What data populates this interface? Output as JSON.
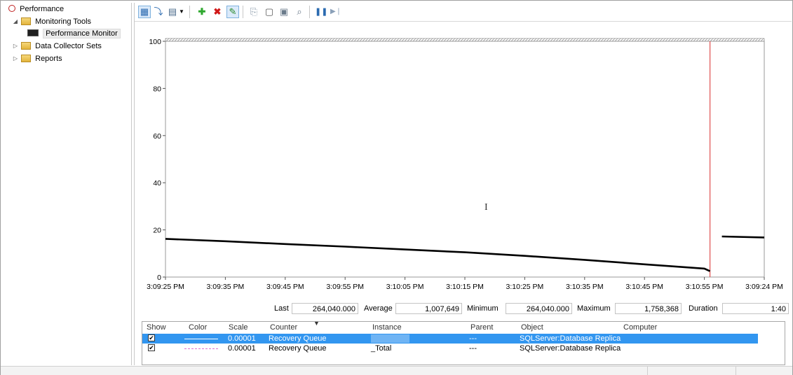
{
  "tree": {
    "items": [
      {
        "label": "Performance",
        "icon": "performance-icon",
        "twisty": ""
      },
      {
        "label": "Monitoring Tools",
        "icon": "folder-icon",
        "twisty": "◢"
      },
      {
        "label": "Performance Monitor",
        "icon": "monitor-icon",
        "twisty": ""
      },
      {
        "label": "Data Collector Sets",
        "icon": "folder-icon",
        "twisty": "▷"
      },
      {
        "label": "Reports",
        "icon": "folder-icon",
        "twisty": "▷"
      }
    ]
  },
  "toolbar": {
    "buttons": [
      {
        "name": "change-graph-type-button",
        "glyph": "▦"
      },
      {
        "name": "view-current-activity-button",
        "glyph": "⤵"
      },
      {
        "name": "change-graph-view-button",
        "glyph": "▤"
      },
      {
        "name": "add-counter-button",
        "glyph": "✚"
      },
      {
        "name": "delete-counter-button",
        "glyph": "✖"
      },
      {
        "name": "highlight-button",
        "glyph": "✎"
      },
      {
        "name": "copy-properties-button",
        "glyph": "⎘"
      },
      {
        "name": "paste-counter-list-button",
        "glyph": "▢"
      },
      {
        "name": "properties-button",
        "glyph": "▣"
      },
      {
        "name": "zoom-button",
        "glyph": "⌕"
      },
      {
        "name": "freeze-display-button",
        "glyph": "❚❚"
      },
      {
        "name": "update-data-button",
        "glyph": "▶❘"
      }
    ]
  },
  "chart_data": {
    "type": "line",
    "ylim": [
      0,
      100
    ],
    "yticks": [
      "0",
      "20",
      "40",
      "60",
      "80",
      "100"
    ],
    "xticks": [
      "3:09:25 PM",
      "3:09:35 PM",
      "3:09:45 PM",
      "3:09:55 PM",
      "3:10:05 PM",
      "3:10:15 PM",
      "3:10:25 PM",
      "3:10:35 PM",
      "3:10:45 PM",
      "3:10:55 PM",
      "3:09:24 PM"
    ],
    "grid": false,
    "series": [
      {
        "color": "#000000",
        "segments": [
          [
            [
              0,
              16.2
            ],
            [
              1,
              15.2
            ],
            [
              2,
              14.0
            ],
            [
              3,
              12.9
            ],
            [
              4,
              11.7
            ],
            [
              5,
              10.5
            ],
            [
              6,
              9.0
            ],
            [
              7,
              7.3
            ],
            [
              8,
              5.4
            ],
            [
              9,
              3.6
            ],
            [
              9.2,
              2.5
            ]
          ],
          [
            [
              9.2,
              17.2
            ],
            [
              10,
              16.8
            ]
          ]
        ]
      }
    ],
    "time_bar_at": 9.0,
    "time_bar_color": "#e05050"
  },
  "stats": {
    "last_label": "Last",
    "last_value": "264,040.000",
    "average_label": "Average",
    "average_value": "1,007,649",
    "minimum_label": "Minimum",
    "minimum_value": "264,040.000",
    "maximum_label": "Maximum",
    "maximum_value": "1,758,368",
    "duration_label": "Duration",
    "duration_value": "1:40"
  },
  "counters": {
    "headers": [
      "Show",
      "Color",
      "Scale",
      "Counter",
      "Instance",
      "Parent",
      "Object",
      "Computer"
    ],
    "rows": [
      {
        "show": "✔",
        "color": "#3296f0",
        "scale": "0.00001",
        "counter": "Recovery Queue",
        "instance": "",
        "parent": "---",
        "object": "SQLServer:Database Replica",
        "computer": ""
      },
      {
        "show": "✔",
        "color": "#e070d0",
        "scale": "0.00001",
        "counter": "Recovery Queue",
        "instance": "_Total",
        "parent": "---",
        "object": "SQLServer:Database Replica",
        "computer": ""
      }
    ]
  }
}
